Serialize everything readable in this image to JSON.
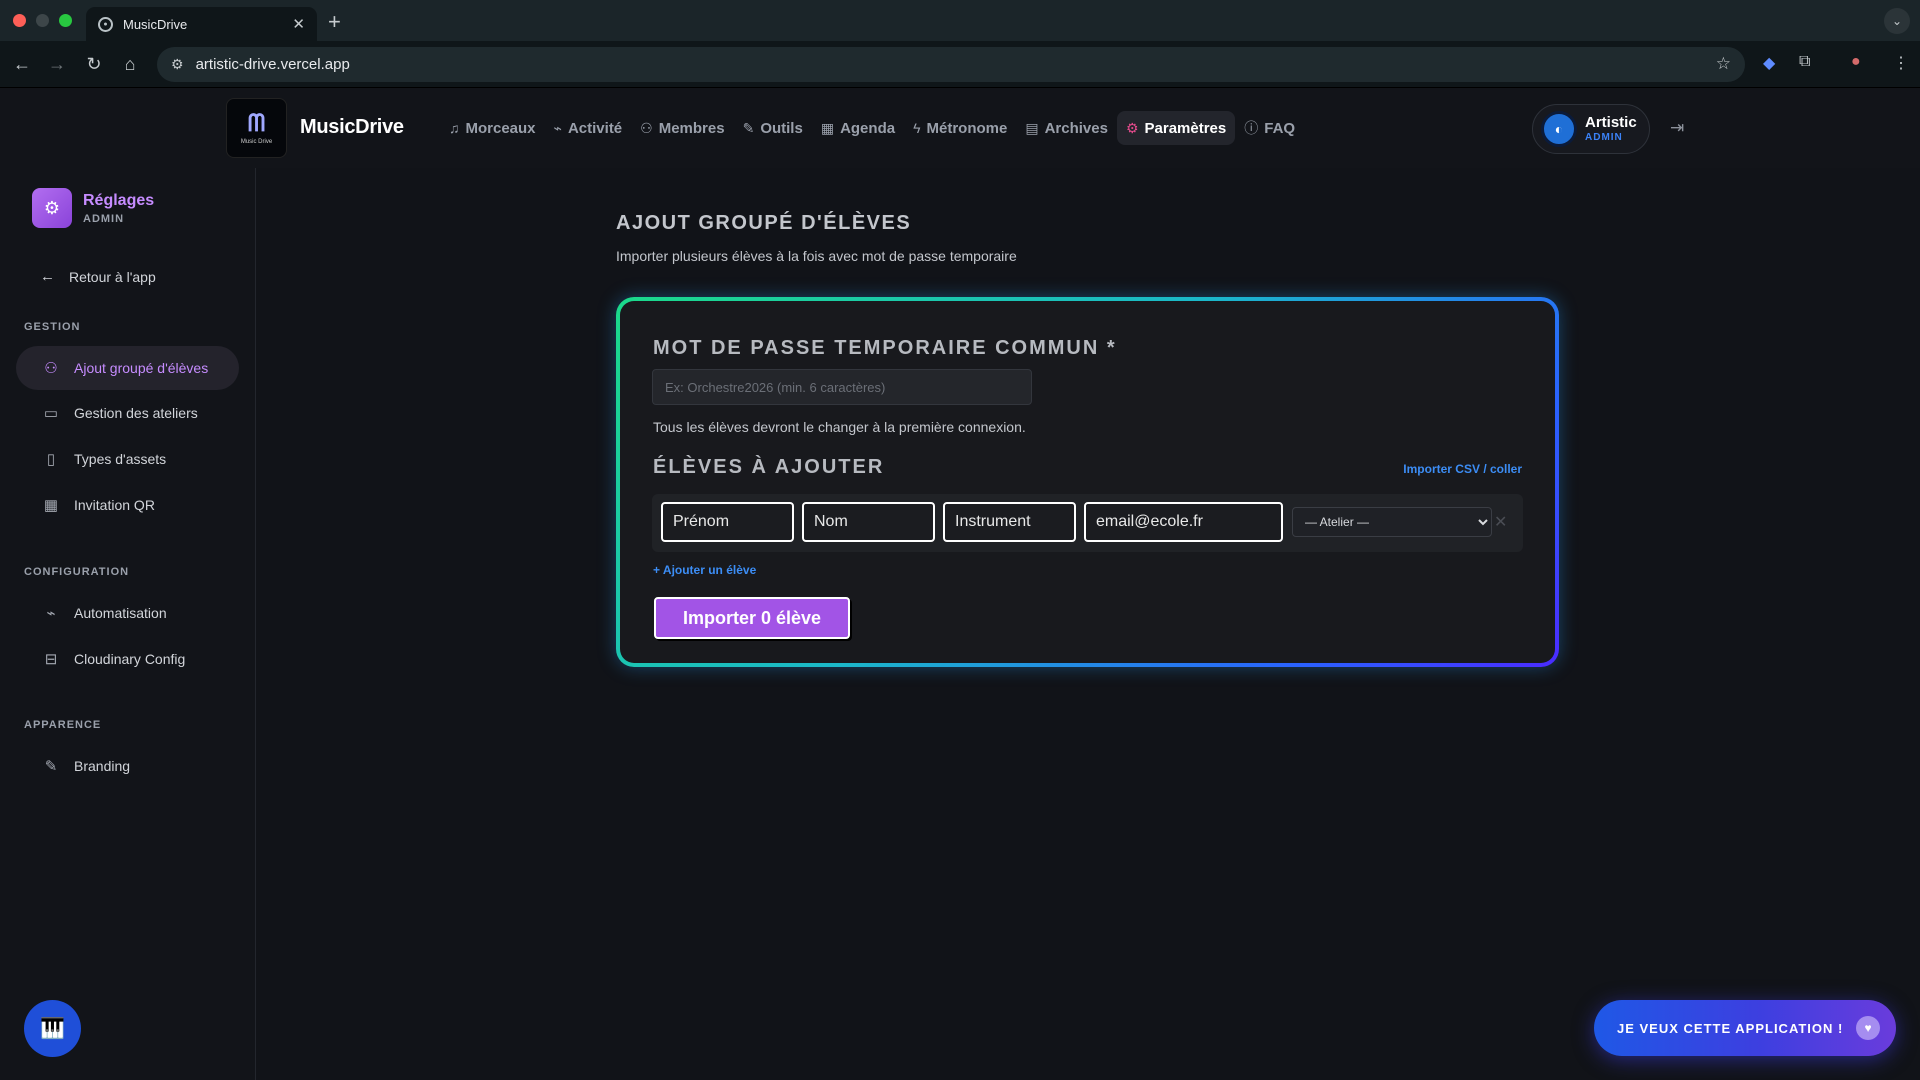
{
  "browser": {
    "tab_title": "MusicDrive",
    "url": "artistic-drive.vercel.app"
  },
  "header": {
    "brand": "MusicDrive",
    "logo_sub": "Music Drive",
    "nav": [
      {
        "label": "Morceaux",
        "icon": "music-note-icon"
      },
      {
        "label": "Activité",
        "icon": "activity-icon"
      },
      {
        "label": "Membres",
        "icon": "users-icon"
      },
      {
        "label": "Outils",
        "icon": "wrench-icon"
      },
      {
        "label": "Agenda",
        "icon": "calendar-icon"
      },
      {
        "label": "Métronome",
        "icon": "bolt-icon"
      },
      {
        "label": "Archives",
        "icon": "archive-icon"
      },
      {
        "label": "Paramètres",
        "icon": "gear-icon",
        "active": true
      },
      {
        "label": "FAQ",
        "icon": "help-icon"
      }
    ],
    "user": {
      "name": "Artistic",
      "role": "ADMIN"
    }
  },
  "sidebar": {
    "title": "Réglages",
    "role": "ADMIN",
    "back": "Retour à l'app",
    "sections": [
      {
        "title": "GESTION",
        "items": [
          "Ajout groupé d'élèves",
          "Gestion des ateliers",
          "Types d'assets",
          "Invitation QR"
        ]
      },
      {
        "title": "CONFIGURATION",
        "items": [
          "Automatisation",
          "Cloudinary Config"
        ]
      },
      {
        "title": "APPARENCE",
        "items": [
          "Branding"
        ]
      }
    ]
  },
  "main": {
    "title": "AJOUT GROUPÉ D'ÉLÈVES",
    "subtitle": "Importer plusieurs élèves à la fois avec mot de passe temporaire",
    "password_label": "MOT DE PASSE TEMPORAIRE COMMUN *",
    "password_placeholder": "Ex: Orchestre2026 (min. 6 caractères)",
    "password_hint": "Tous les élèves devront le changer à la première connexion.",
    "students_label": "ÉLÈVES À AJOUTER",
    "import_csv": "Importer CSV / coller",
    "row": {
      "firstname_placeholder": "Prénom",
      "lastname_placeholder": "Nom",
      "instrument_placeholder": "Instrument",
      "email_placeholder": "email@ecole.fr",
      "atelier_option": "— Atelier —"
    },
    "add_student": "+ Ajouter un élève",
    "import_button": "Importer 0 élève"
  },
  "cta": {
    "label": "JE VEUX CETTE APPLICATION !"
  },
  "colors": {
    "accent_purple": "#a254e6",
    "link_blue": "#3c8df5",
    "cta_blue": "#1f58e6"
  }
}
